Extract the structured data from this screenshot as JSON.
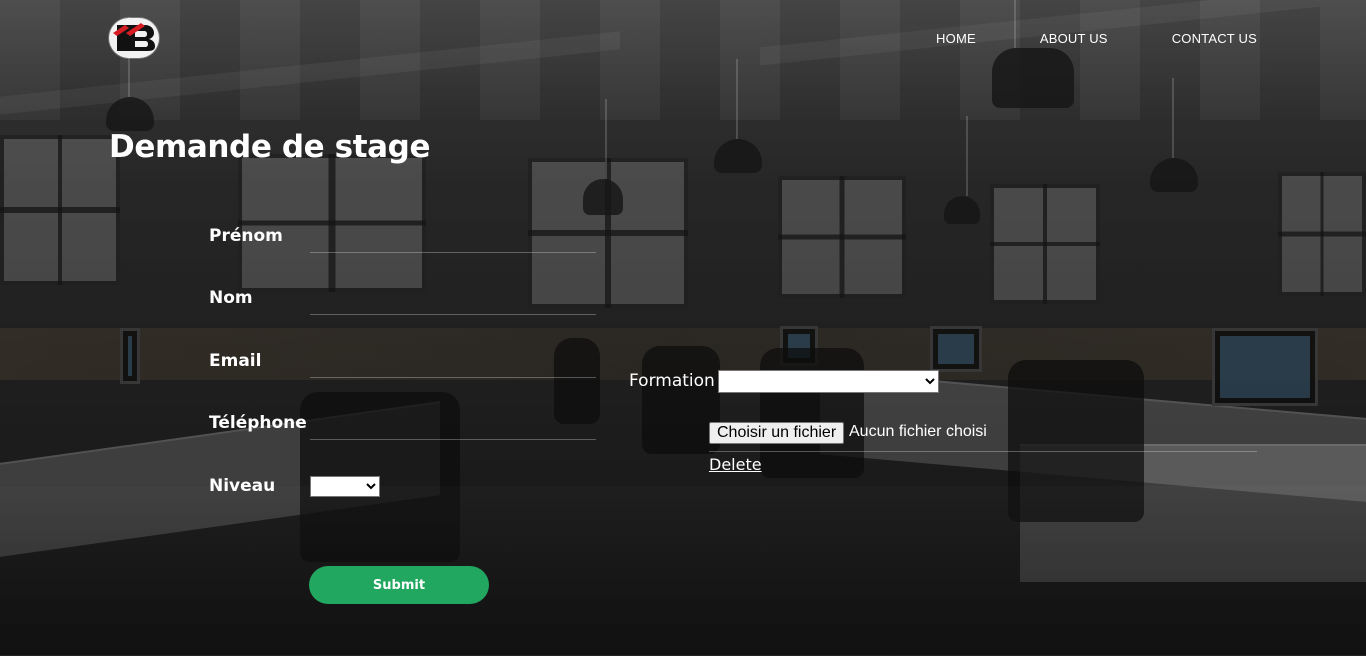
{
  "header": {
    "nav": [
      "HOME",
      "ABOUT US",
      "CONTACT US"
    ]
  },
  "main": {
    "title": "Demande de stage",
    "fields": {
      "prenom": "Prénom",
      "nom": "Nom",
      "email": "Email",
      "telephone": "Téléphone",
      "niveau": "Niveau"
    },
    "niveau_selected": "",
    "formation_label": "Formation",
    "formation_selected": "",
    "file_button": "Choisir un fichier",
    "file_status": "Aucun fichier choisi",
    "delete_label": "Delete",
    "submit_label": "Submit"
  },
  "colors": {
    "accent": "#22a760",
    "text": "#ffffff",
    "overlay": "#121212"
  },
  "icons": {
    "logo": "ib-logo"
  }
}
